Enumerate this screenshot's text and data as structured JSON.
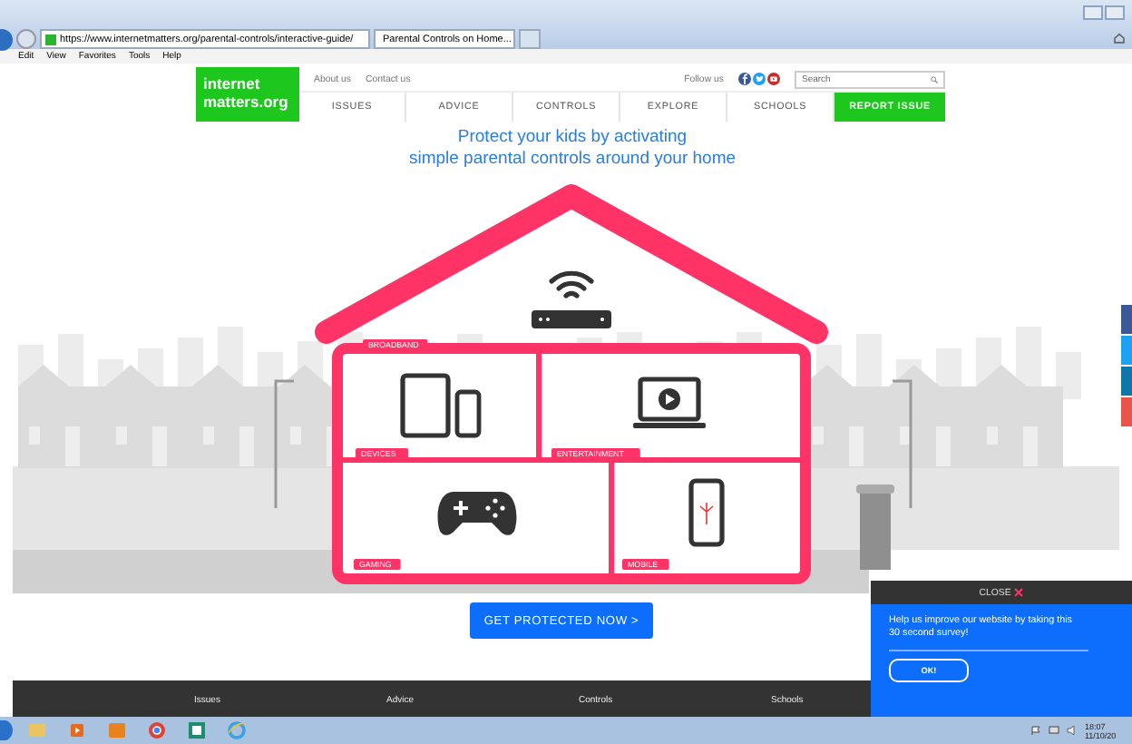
{
  "browser": {
    "address": "https://www.internetmatters.org/parental-controls/interactive-guide/",
    "tabs": [
      {
        "label": "Parental Controls on Home...",
        "selected": true
      }
    ],
    "menu": [
      "Edit",
      "View",
      "Favorites",
      "Tools",
      "Help"
    ]
  },
  "site": {
    "logo": [
      "internet",
      "matters.org"
    ],
    "top_links": [
      "About us",
      "Contact us"
    ],
    "follow_label": "Follow us",
    "search": {
      "placeholder": "Search"
    },
    "nav": [
      {
        "label": "ISSUES",
        "kind": "link"
      },
      {
        "label": "ADVICE",
        "kind": "link"
      },
      {
        "label": "CONTROLS",
        "kind": "link"
      },
      {
        "label": "EXPLORE",
        "kind": "link"
      },
      {
        "label": "SCHOOLS",
        "kind": "link"
      },
      {
        "label": "REPORT ISSUE",
        "kind": "cta"
      }
    ]
  },
  "headline": [
    "Protect your kids by activating",
    "simple parental controls around your home"
  ],
  "house": {
    "rooms": [
      {
        "label": "BROADBAND",
        "kind": "broadband"
      },
      {
        "label": "DEVICES",
        "kind": "devices"
      },
      {
        "label": "ENTERTAINMENT",
        "kind": "entertainment"
      },
      {
        "label": "GAMING",
        "kind": "gaming"
      },
      {
        "label": "MOBILE",
        "kind": "mobile"
      }
    ]
  },
  "cta_button": "GET PROTECTED NOW >",
  "footer": {
    "columns": [
      "Issues",
      "Advice",
      "Controls",
      "Schools"
    ]
  },
  "survey_popup": {
    "close": "CLOSE",
    "message": "Help us improve our website by taking this 30 second survey!",
    "button": "OK!"
  },
  "taskbar": {
    "time": "18:07",
    "date": "11/10/20"
  }
}
